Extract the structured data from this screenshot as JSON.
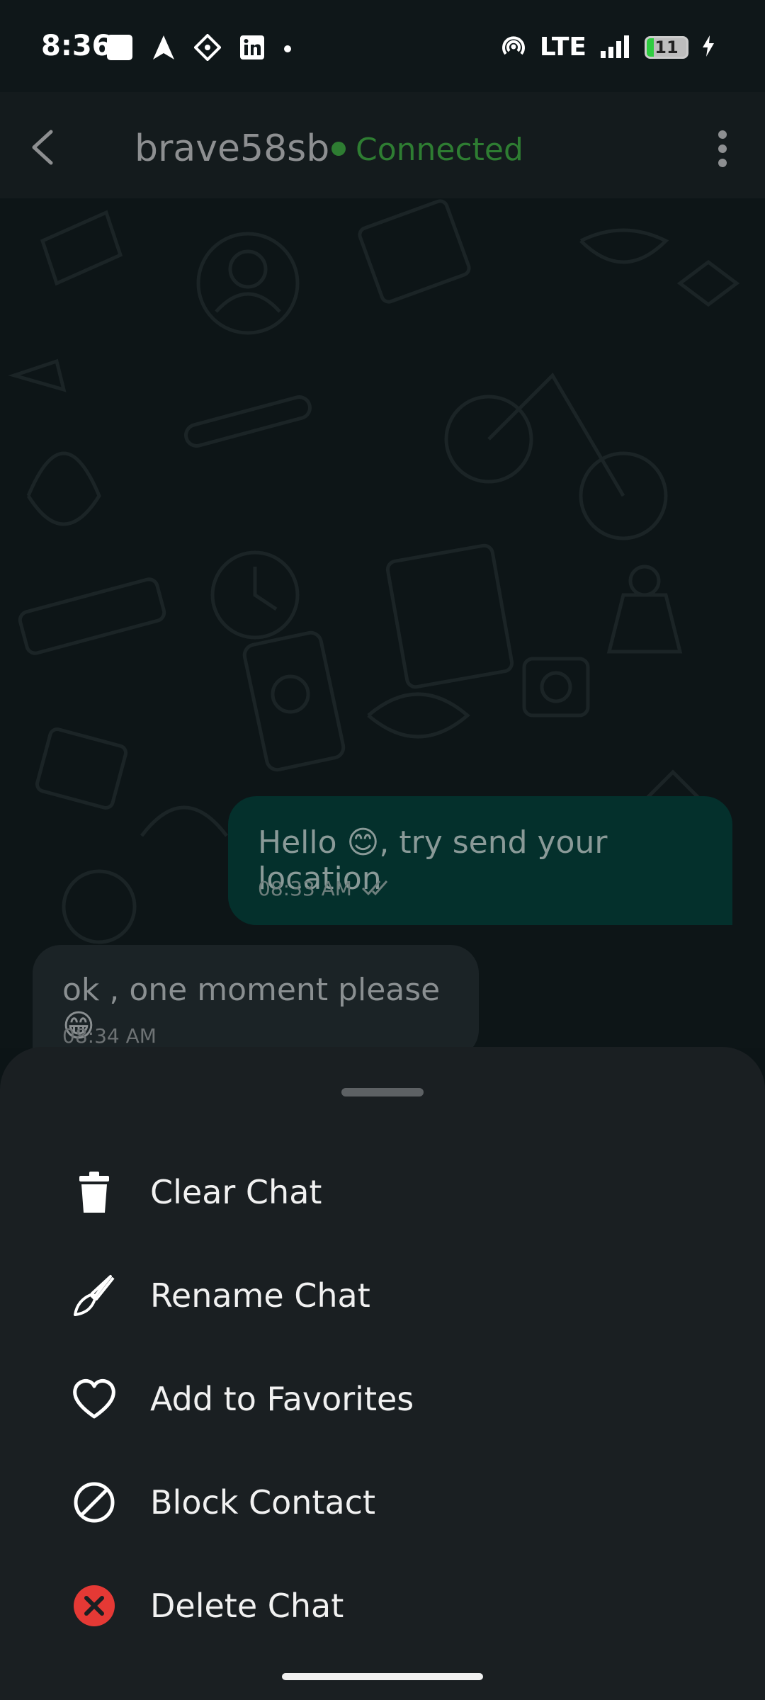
{
  "status": {
    "time": "8:36",
    "network": "LTE",
    "battery": "11"
  },
  "header": {
    "name": "brave58sb",
    "status": "Connected"
  },
  "messages": [
    {
      "text": "Hello 😊, try send your location",
      "time": "08:33 AM",
      "outgoing": true
    },
    {
      "text": "ok , one moment please 😁",
      "time": "08:34 AM",
      "outgoing": false
    }
  ],
  "sheet": {
    "items": [
      {
        "label": "Clear Chat",
        "icon": "trash-icon"
      },
      {
        "label": "Rename Chat",
        "icon": "brush-icon"
      },
      {
        "label": "Add to Favorites",
        "icon": "heart-icon"
      },
      {
        "label": "Block Contact",
        "icon": "block-icon"
      },
      {
        "label": "Delete Chat",
        "icon": "delete-circle-icon"
      }
    ]
  },
  "colors": {
    "accent": "#2e7d32",
    "danger": "#e53935",
    "outgoing_bubble": "#04302c",
    "sheet_bg": "#1a1f22"
  }
}
